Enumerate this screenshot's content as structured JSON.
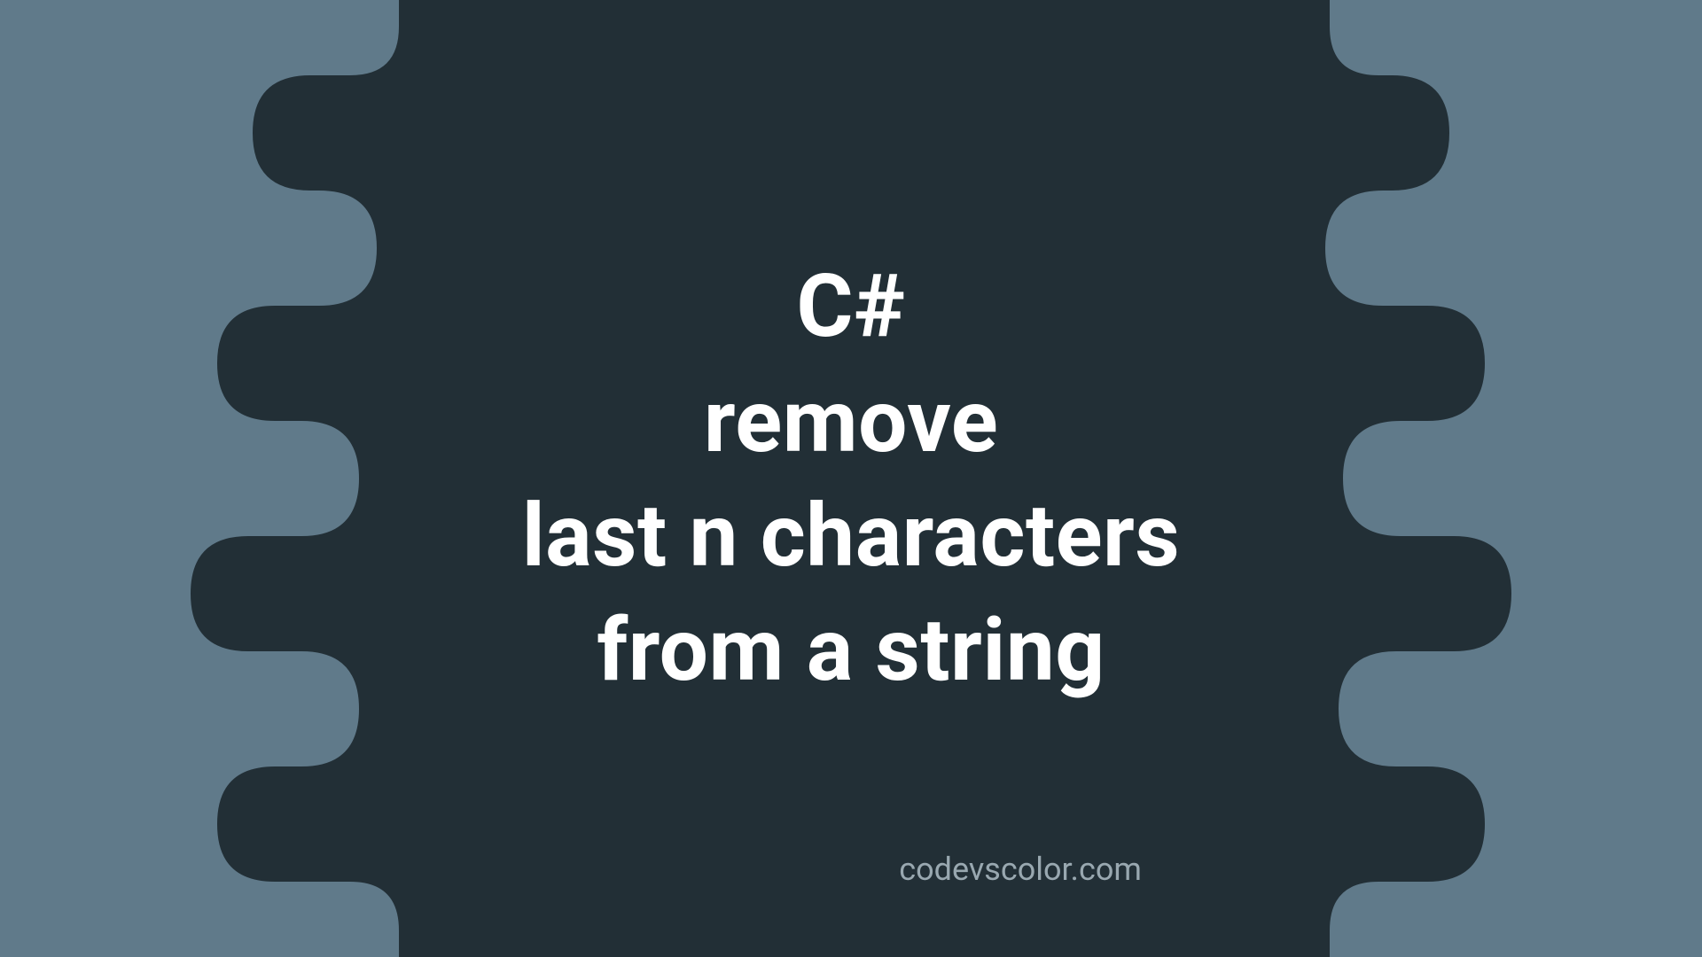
{
  "title": {
    "line1": "C#",
    "line2": "remove",
    "line3": "last n characters",
    "line4": "from a string"
  },
  "watermark": "codevscolor.com",
  "colors": {
    "background": "#607a8a",
    "blob": "#222f36",
    "text": "#ffffff",
    "watermark": "#99a8b0"
  }
}
